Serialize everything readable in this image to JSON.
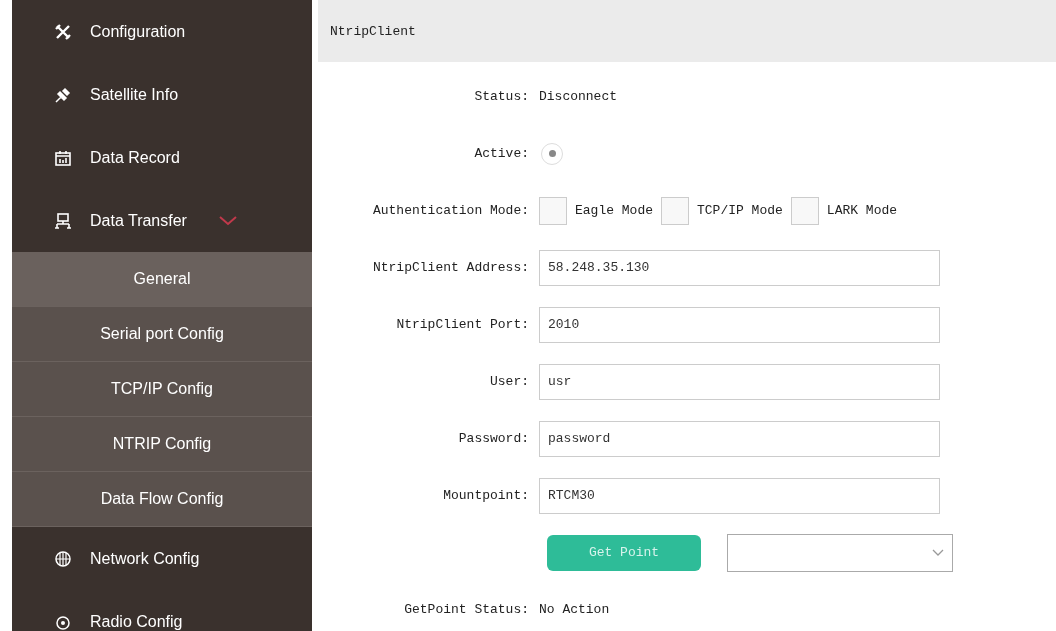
{
  "sidebar": {
    "items": [
      {
        "label": "Configuration"
      },
      {
        "label": "Satellite Info"
      },
      {
        "label": "Data Record"
      },
      {
        "label": "Data Transfer",
        "expanded": true,
        "children": [
          {
            "label": "General",
            "selected": true
          },
          {
            "label": "Serial port Config",
            "selected": false
          },
          {
            "label": "TCP/IP Config",
            "selected": false
          },
          {
            "label": "NTRIP Config",
            "selected": false
          },
          {
            "label": "Data Flow Config",
            "selected": false
          }
        ]
      },
      {
        "label": "Network Config"
      },
      {
        "label": "Radio Config"
      }
    ]
  },
  "panel": {
    "title": "NtripClient",
    "rows": [
      {
        "kind": "text",
        "label": "Status:",
        "value": "Disconnect"
      },
      {
        "kind": "radio",
        "label": "Active:",
        "checked": true
      },
      {
        "kind": "checks",
        "label": "Authentication Mode:",
        "options": [
          {
            "label": "Eagle Mode",
            "checked": false
          },
          {
            "label": "TCP/IP Mode",
            "checked": false
          },
          {
            "label": "LARK Mode",
            "checked": false
          }
        ]
      },
      {
        "kind": "input",
        "label": "NtripClient Address:",
        "value": "58.248.35.130"
      },
      {
        "kind": "input",
        "label": "NtripClient Port:",
        "value": "2010"
      },
      {
        "kind": "input",
        "label": "User:",
        "value": "usr"
      },
      {
        "kind": "input",
        "label": "Password:",
        "value": "password"
      },
      {
        "kind": "input",
        "label": "Mountpoint:",
        "value": "RTCM30"
      },
      {
        "kind": "action",
        "button": "Get Point"
      },
      {
        "kind": "text",
        "label": "GetPoint Status:",
        "value": "No Action"
      }
    ]
  }
}
